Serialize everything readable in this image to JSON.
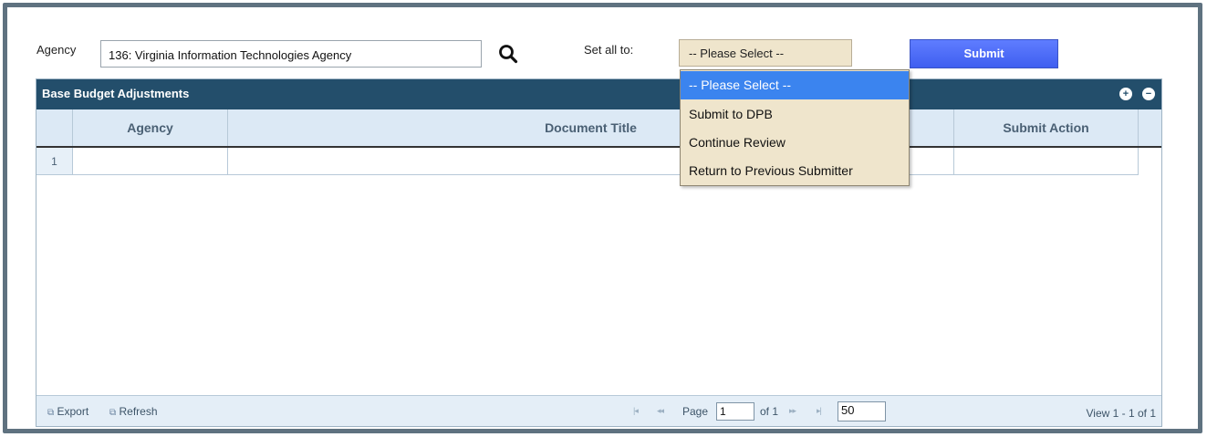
{
  "form": {
    "agency_label": "Agency",
    "agency_value": "136: Virginia Information Technologies Agency",
    "set_all_label": "Set all to:",
    "set_all_selected": "-- Please Select --",
    "submit_label": "Submit"
  },
  "dropdown": {
    "options": [
      "-- Please Select --",
      "Submit to DPB",
      "Continue Review",
      "Return to Previous Submitter"
    ]
  },
  "grid": {
    "title": "Base Budget Adjustments",
    "columns": [
      "Agency",
      "Document Title",
      "Submit Action"
    ],
    "rows": [
      {
        "num": "1",
        "agency": "",
        "document_title": "",
        "submit_action": ""
      }
    ]
  },
  "footer": {
    "export_label": "Export",
    "refresh_label": "Refresh",
    "page_label": "Page",
    "page_value": "1",
    "of_label": "of 1",
    "rows_per_page": "50",
    "view_text": "View 1 - 1 of 1"
  },
  "icons": [
    "search-icon",
    "expand-icon",
    "collapse-icon",
    "export-icon",
    "refresh-icon",
    "first-page-icon",
    "prev-page-icon",
    "next-page-icon",
    "last-page-icon"
  ],
  "colors": {
    "header_bar": "#234e6b",
    "submit_button": "#4a6af7",
    "select_bg": "#efe5cc",
    "option_highlight": "#3b84ef",
    "column_header_bg": "#dce9f5"
  }
}
